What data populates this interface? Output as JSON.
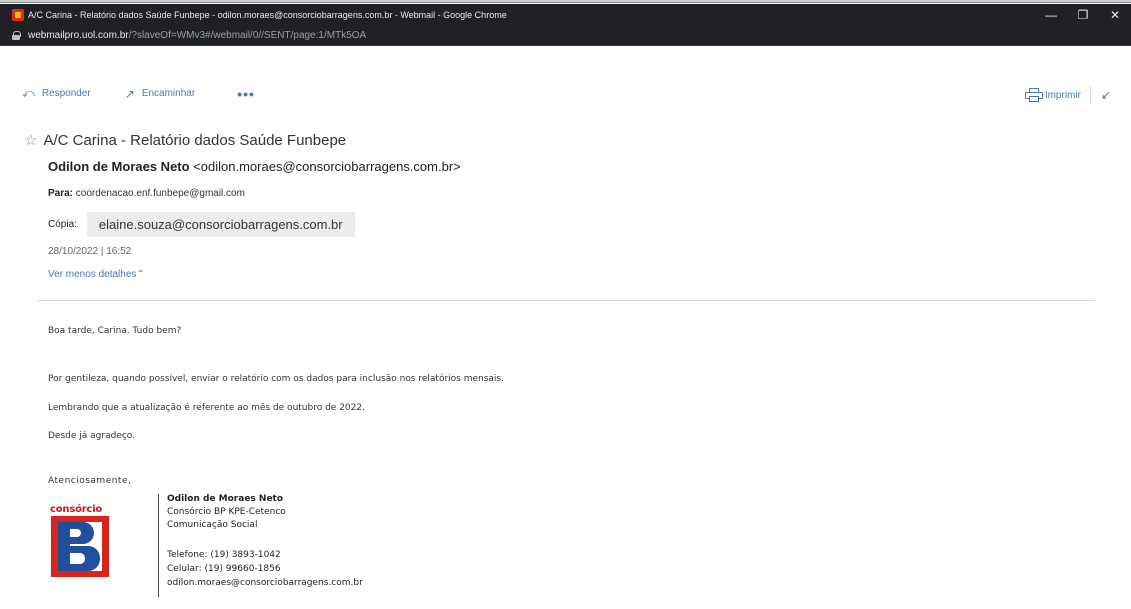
{
  "window": {
    "title": "A/C Carina - Relatório dados Saúde Funbepe - odilon.moraes@consorciobarragens.com.br - Webmail - Google Chrome",
    "url_host": "webmailpro.uol.com.br",
    "url_path": "/?slaveOf=WMv3#/webmail/0//SENT/page:1/MTk5OA",
    "minimize": "—",
    "restore": "❐",
    "close": "✕"
  },
  "toolbar": {
    "reply_label": "Responder",
    "reply_icon": "⤺",
    "forward_label": "Encaminhar",
    "forward_icon": "↗",
    "more_label": "•••",
    "print_label": "Imprimir",
    "collapse_icon": "↙"
  },
  "email": {
    "star_icon": "☆",
    "subject": "A/C Carina - Relatório dados Saúde Funbepe",
    "sender_name": "Odilon de Moraes Neto",
    "sender_email": "<odilon.moraes@consorciobarragens.com.br>",
    "to_label": "Para:",
    "to_value": "coordenacao.enf.funbepe@gmail.com",
    "cc_label": "Cópia:",
    "cc_value": "elaine.souza@consorciobarragens.com.br",
    "date": "28/10/2022 | 16:52",
    "details_link": "Ver menos detalhes",
    "details_icon": "⌃"
  },
  "body": {
    "greeting": "Boa tarde, Carina. Tudo bem?",
    "line1": "Por gentileza, quando possível, enviar o relatório com os dados para inclusão nos relatórios mensais.",
    "line2": "Lembrando que a atualização é referente ao mês de outubro de 2022.",
    "line3": "Desde já agradeço.",
    "closing": "Atenciosamente,"
  },
  "signature": {
    "logo_text": "consórcio",
    "name": "Odilon de Moraes Neto",
    "company": "Consórcio BP KPE-Cetenco",
    "department": "Comunicação Social",
    "phone": "Telefone: (19) 3893-1042",
    "mobile": "Celular:  (19) 99660-1856",
    "email": "odilon.moraes@consorciobarragens.com.br"
  },
  "colors": {
    "link": "#4a78b5",
    "chrome_bg": "#202124",
    "logo_red": "#d9231d",
    "logo_blue": "#1f4f9d"
  }
}
